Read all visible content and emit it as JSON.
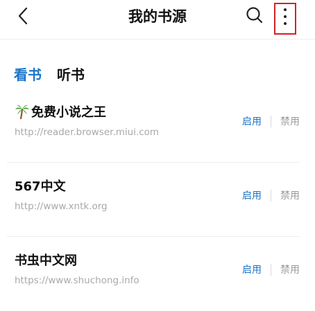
{
  "header": {
    "title": "我的书源",
    "icons": {
      "back": "chevron-left-icon",
      "search": "search-icon",
      "more": "more-vertical-icon"
    },
    "highlight_color": "#d32027"
  },
  "tabs": [
    {
      "label": "看书",
      "active": true
    },
    {
      "label": "听书",
      "active": false
    }
  ],
  "colors": {
    "accent": "#1b74c8",
    "muted": "#9a9a9a"
  },
  "sources": [
    {
      "name": "免费小说之王",
      "icon": "palm-tree-emoji",
      "url": "http://reader.browser.miui.com",
      "enable_label": "启用",
      "disable_label": "禁用"
    },
    {
      "name": "567中文",
      "url": "http://www.xntk.org",
      "enable_label": "启用",
      "disable_label": "禁用"
    },
    {
      "name": "书虫中文网",
      "url": "https://www.shuchong.info",
      "enable_label": "启用",
      "disable_label": "禁用"
    }
  ]
}
